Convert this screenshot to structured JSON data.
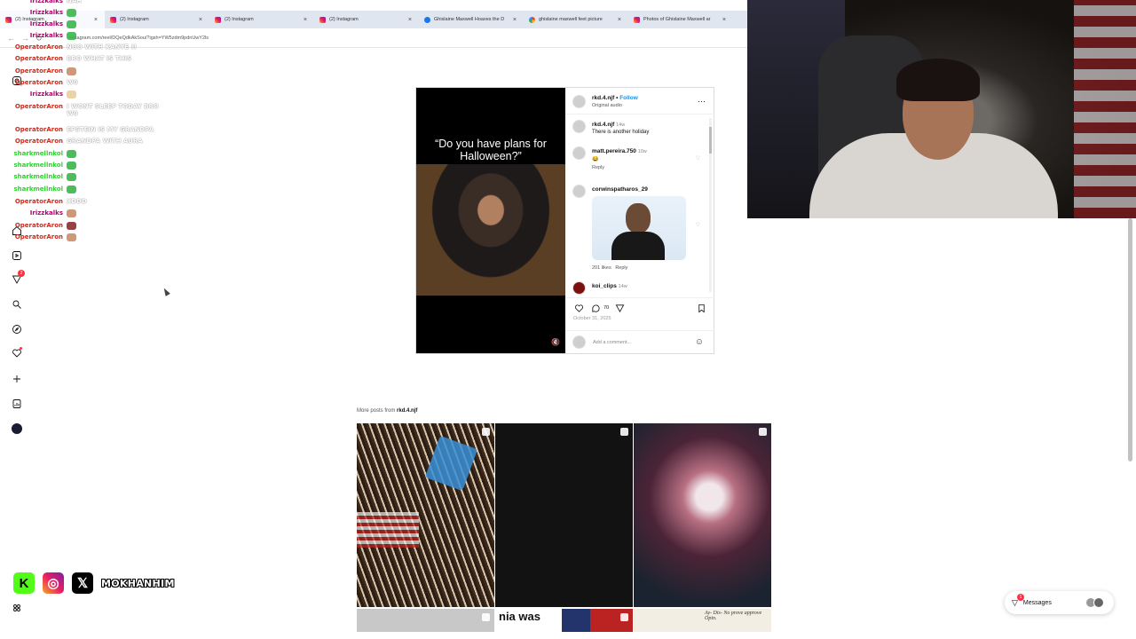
{
  "tabs": [
    {
      "label": "(2) Instagram",
      "icon": "instagram-icon",
      "active": true
    },
    {
      "label": "(2) Instagram",
      "icon": "instagram-icon"
    },
    {
      "label": "(2) Instagram",
      "icon": "instagram-icon"
    },
    {
      "label": "(2) Instagram",
      "icon": "instagram-icon"
    },
    {
      "label": "Ghislaine Maxwell Hoaxes the D",
      "icon": "facebook-icon"
    },
    {
      "label": "ghislaine maxwell feet picture",
      "icon": "google-icon"
    },
    {
      "label": "Photos of Ghislaine Maxwell ar",
      "icon": "instagram-icon"
    }
  ],
  "address": "instagram.com/reel/DQeQdkAkSou/?igsh=YW5zdm9pdnUwY2ls",
  "chat": [
    {
      "user": "Irizzkalks",
      "text": "NAH",
      "emote": "",
      "cls": "u-rizz"
    },
    {
      "user": "Irizzkalks",
      "text": "",
      "emote": "green",
      "cls": "u-rizz"
    },
    {
      "user": "Irizzkalks",
      "text": "",
      "emote": "green",
      "cls": "u-rizz"
    },
    {
      "user": "Irizzkalks",
      "text": "",
      "emote": "green",
      "cls": "u-rizz"
    },
    {
      "user": "OperatorAron",
      "text": "NOO WITH KANYE !!",
      "emote": "",
      "cls": "u-aron"
    },
    {
      "user": "OperatorAron",
      "text": "BRO WHAT IS THIS",
      "emote": "",
      "cls": "u-aron"
    },
    {
      "user": "OperatorAron",
      "text": "",
      "emote": "face",
      "cls": "u-aron"
    },
    {
      "user": "OperatorAron",
      "text": "W0",
      "emote": "",
      "cls": "u-aron"
    },
    {
      "user": "Irizzkalks",
      "text": "",
      "emote": "hand",
      "cls": "u-rizz"
    },
    {
      "user": "OperatorAron",
      "text": "I WONT SLEEP TODAY BRO W0",
      "emote": "",
      "cls": "u-aron"
    },
    {
      "user": "OperatorAron",
      "text": "EPSTEIN IS MY GRANDPA",
      "emote": "",
      "cls": "u-aron"
    },
    {
      "user": "OperatorAron",
      "text": "GRANDPA WITH AURA",
      "emote": "",
      "cls": "u-aron"
    },
    {
      "user": "sharkmellnkol",
      "text": "",
      "emote": "green",
      "cls": "u-shark"
    },
    {
      "user": "sharkmellnkol",
      "text": "",
      "emote": "green",
      "cls": "u-shark"
    },
    {
      "user": "sharkmellnkol",
      "text": "",
      "emote": "green",
      "cls": "u-shark"
    },
    {
      "user": "sharkmellnkol",
      "text": "",
      "emote": "green",
      "cls": "u-shark"
    },
    {
      "user": "OperatorAron",
      "text": "XDDD",
      "emote": "",
      "cls": "u-aron"
    },
    {
      "user": "Irizzkalks",
      "text": "",
      "emote": "face",
      "cls": "u-rizz"
    },
    {
      "user": "OperatorAron",
      "text": "",
      "emote": "red",
      "cls": "u-aron"
    },
    {
      "user": "OperatorAron",
      "text": "",
      "emote": "face",
      "cls": "u-aron"
    }
  ],
  "post": {
    "caption": "“Do you have plans for Halloween?”",
    "author": "rkd.4.njf",
    "follow": "Follow",
    "audio": "Original audio",
    "comments": [
      {
        "user": "rkd.4.njf",
        "time": "14w",
        "text": "There is another holiday"
      },
      {
        "user": "matt.pereira.750",
        "time": "10w",
        "text": "😂",
        "reply": "Reply"
      },
      {
        "user": "corwinspatharos_29",
        "time": "",
        "text": "",
        "likes": "201 likes",
        "reply": "Reply"
      },
      {
        "user": "koi_clips",
        "time": "14w",
        "text": ""
      }
    ],
    "comment_count": "70",
    "date": "October 31, 2025",
    "add_comment": "Add a comment..."
  },
  "more_posts": {
    "prefix": "More posts from",
    "author": "rkd.4.njf"
  },
  "grid_texts": {
    "was_text": "nia was",
    "paper_text": "Ay- Dis- No\nprove approve Opin."
  },
  "socials": {
    "handle": "MOKHANHIM"
  },
  "messages": {
    "label": "Messages",
    "badge": "1"
  },
  "nav_badge": "2"
}
